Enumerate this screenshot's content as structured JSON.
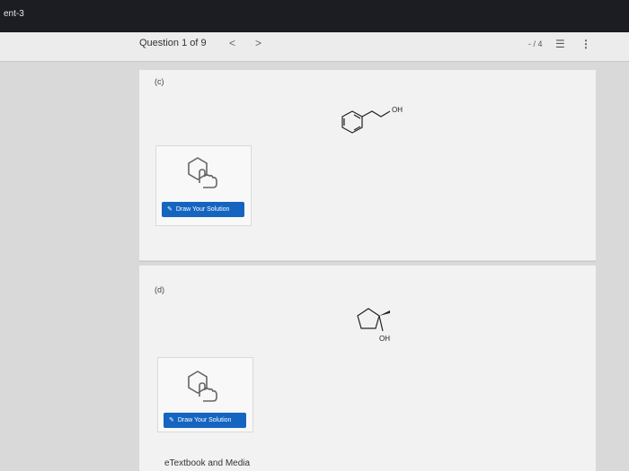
{
  "browser": {
    "tab_title": "ent-3"
  },
  "header": {
    "question_label": "Question 1 of 9",
    "prev_glyph": "<",
    "next_glyph": ">",
    "score": "- / 4",
    "list_glyph": "☰",
    "more_glyph": "⋮"
  },
  "parts": [
    {
      "label": "(c)",
      "draw_button_label": "Draw Your Solution",
      "molecule_label": "OH"
    },
    {
      "label": "(d)",
      "draw_button_label": "Draw Your Solution",
      "molecule_label": "OH"
    }
  ],
  "footer": {
    "etextbook_label": "eTextbook and Media"
  },
  "icons": {
    "draw": "hand-pointer-benzene-icon",
    "pencil": "pencil-icon"
  },
  "colors": {
    "button": "#1565c0",
    "topbar": "#1b1d22"
  }
}
